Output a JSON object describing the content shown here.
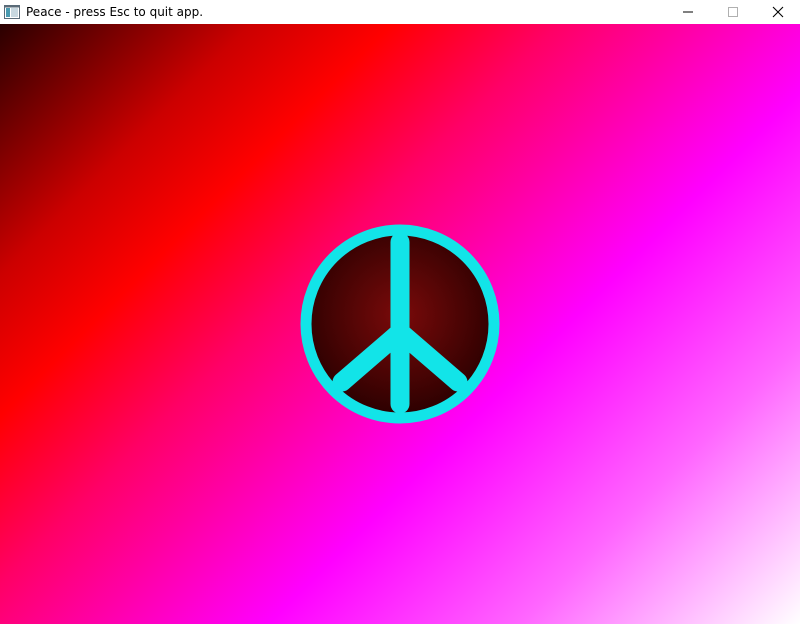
{
  "window": {
    "title": "Peace - press Esc to quit app.",
    "controls": {
      "minimize_icon": "minimize-icon",
      "maximize_icon": "maximize-icon",
      "close_icon": "close-icon"
    }
  },
  "colors": {
    "symbol": "#12e4e8",
    "symbol_center": "#7a0a0a",
    "symbol_edge": "#2a0000",
    "background_start": "#2a0000",
    "background_mid_red": "#ff0000",
    "background_magenta": "#ff00ff",
    "background_end": "#ffffff"
  },
  "icons": {
    "app": "app-window-icon",
    "symbol": "peace-symbol-icon"
  }
}
